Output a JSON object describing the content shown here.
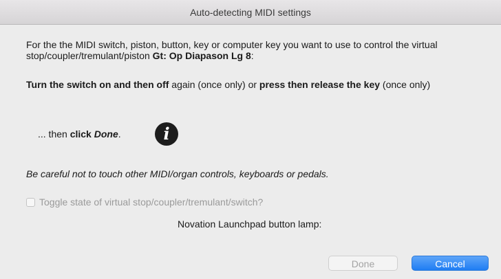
{
  "window": {
    "title": "Auto-detecting MIDI settings"
  },
  "instructions": {
    "p1_text": "For the the MIDI switch, piston, button, key or computer key you want to use to control the virtual stop/coupler/tremulant/piston ",
    "p1_target": "Gt: Op Diapason Lg 8",
    "p1_end": ":",
    "p2_bold1": "Turn the switch on and then off",
    "p2_mid": " again (once only) or ",
    "p2_bold2": "press then release the key",
    "p2_end": " (once only)",
    "p3_prefix": "... then ",
    "p3_bold": "click ",
    "p3_bold_italic": "Done",
    "p3_end": ".",
    "info_icon_glyph": "i",
    "p4_warning": "Be careful not to touch other MIDI/organ controls, keyboards or pedals."
  },
  "options": {
    "toggle_label": "Toggle state of virtual stop/coupler/tremulant/switch?",
    "toggle_checked": false,
    "lamp_label": "Novation Launchpad button lamp:"
  },
  "buttons": {
    "done_label": "Done",
    "cancel_label": "Cancel"
  },
  "colors": {
    "accent": "#1f7df3",
    "background": "#ececec"
  }
}
